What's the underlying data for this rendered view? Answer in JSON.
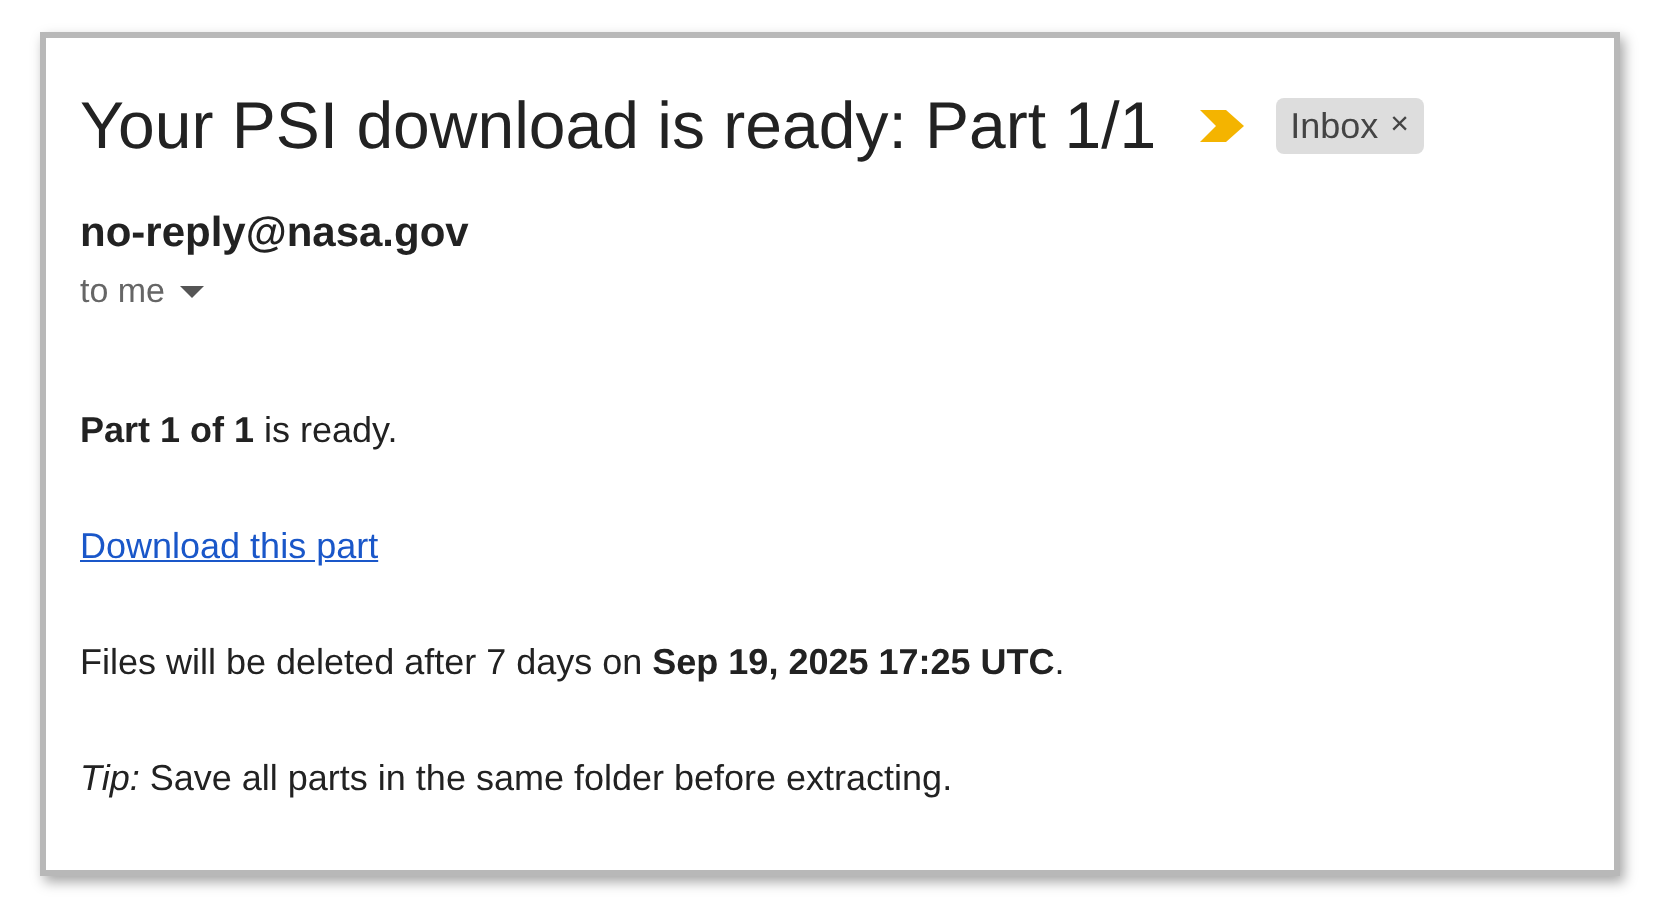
{
  "subject": "Your PSI download is ready: Part 1/1",
  "important": true,
  "label": {
    "text": "Inbox",
    "close": "×"
  },
  "sender": "no-reply@nasa.gov",
  "recipient": "to me",
  "body": [
    {
      "kind": "text",
      "text": "**Part 1 of 1** is ready."
    },
    {
      "kind": "link",
      "text": "Download this part"
    },
    {
      "kind": "text",
      "text": "Files will be deleted after 7 days on **Sep 19, 2025 17:25 UTC**."
    },
    {
      "kind": "text",
      "text": "*Tip:* Save all parts in the same folder before extracting."
    }
  ]
}
